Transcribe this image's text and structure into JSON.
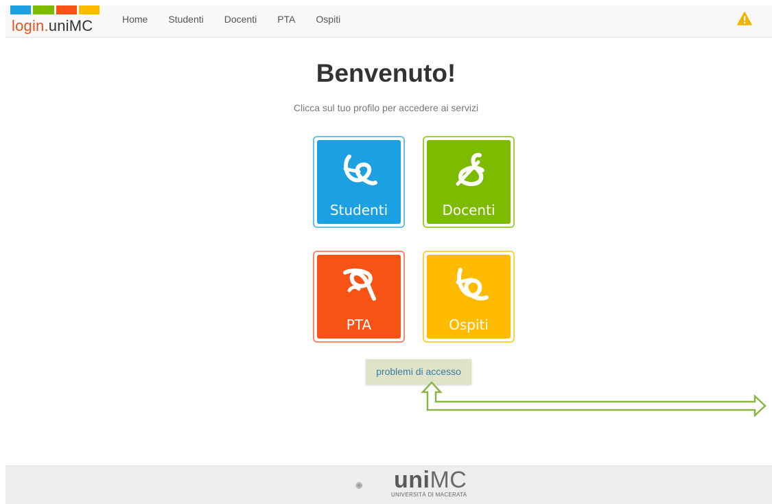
{
  "header": {
    "logo_text_part1": "login.",
    "logo_text_part2": "uniMC",
    "logo_colors": [
      "#1ba1e2",
      "#7cbb00",
      "#f65314",
      "#ffbb00"
    ],
    "nav": [
      "Home",
      "Studenti",
      "Docenti",
      "PTA",
      "Ospiti"
    ],
    "alert_icon": "warning-icon",
    "alert_color": "#f0b400"
  },
  "main": {
    "title": "Benvenuto!",
    "subtitle": "Clicca sul tuo profilo per accedere ai servizi",
    "tiles": [
      {
        "label": "Studenti",
        "color": "#1ba1e2",
        "border": "#62c0ee",
        "icon": "knot-studenti-icon"
      },
      {
        "label": "Docenti",
        "color": "#7cbb00",
        "border": "#9fd12e",
        "icon": "knot-docenti-icon"
      },
      {
        "label": "PTA",
        "color": "#f65314",
        "border": "#f7896a",
        "icon": "knot-pta-icon"
      },
      {
        "label": "Ospiti",
        "color": "#ffbb00",
        "border": "#ffd040",
        "icon": "knot-ospiti-icon"
      }
    ],
    "help_link": "problemi di accesso",
    "annotation_color": "#8ab446"
  },
  "footer": {
    "brand_bold": "uni",
    "brand_thin": "MC",
    "subtitle": "UNIVERSITÀ DI MACERATA"
  }
}
